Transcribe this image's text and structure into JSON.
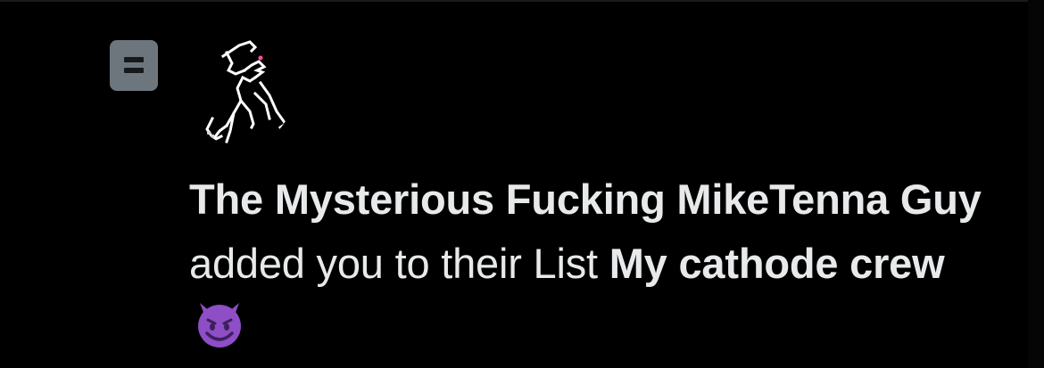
{
  "notification": {
    "type_icon": "list-icon",
    "avatar_icon": "dancing-figure-avatar-icon",
    "actor_name": "The Mysterious Fucking MikeTenna Guy",
    "action_text": "added you to their List",
    "list_name": "My cathode crew",
    "emoji_icon": "smiling-face-with-horns-icon"
  },
  "colors": {
    "background": "#000000",
    "text": "#e7e9ea",
    "list_icon_bg": "#6e767d",
    "emoji_purple": "#8e4ec6"
  }
}
